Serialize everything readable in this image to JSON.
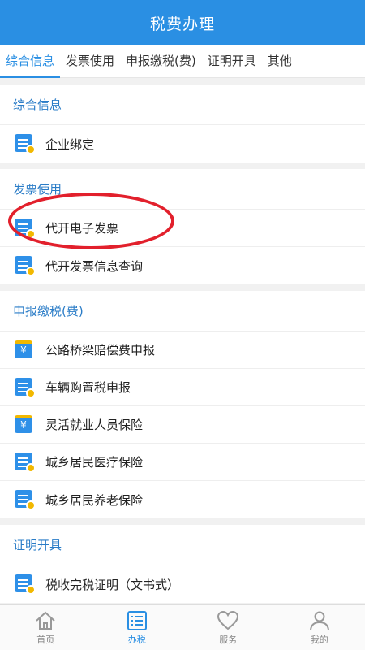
{
  "header": {
    "title": "税费办理"
  },
  "tabs": [
    {
      "label": "综合信息"
    },
    {
      "label": "发票使用"
    },
    {
      "label": "申报缴税(费)"
    },
    {
      "label": "证明开具"
    },
    {
      "label": "其他"
    }
  ],
  "sections": [
    {
      "title": "综合信息",
      "items": [
        {
          "label": "企业绑定"
        }
      ]
    },
    {
      "title": "发票使用",
      "items": [
        {
          "label": "代开电子发票"
        },
        {
          "label": "代开发票信息查询"
        }
      ]
    },
    {
      "title": "申报缴税(费)",
      "items": [
        {
          "label": "公路桥梁赔偿费申报",
          "coin": "¥"
        },
        {
          "label": "车辆购置税申报"
        },
        {
          "label": "灵活就业人员保险",
          "coin": "¥"
        },
        {
          "label": "城乡居民医疗保险"
        },
        {
          "label": "城乡居民养老保险"
        }
      ]
    },
    {
      "title": "证明开具",
      "items": [
        {
          "label": "税收完税证明（文书式）"
        }
      ]
    }
  ],
  "bottom_nav": [
    {
      "label": "首页"
    },
    {
      "label": "办税"
    },
    {
      "label": "服务"
    },
    {
      "label": "我的"
    }
  ],
  "colors": {
    "primary": "#2a8fe3",
    "accent": "#f2b800",
    "highlight": "#e2202c"
  }
}
